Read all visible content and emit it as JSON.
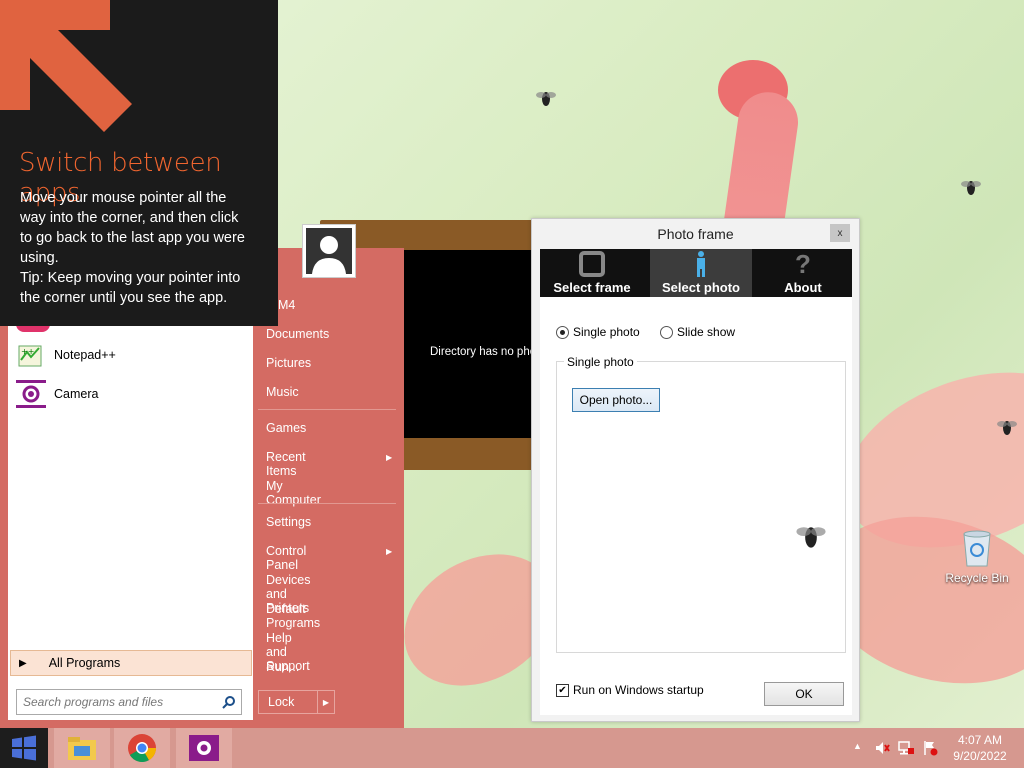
{
  "tooltip": {
    "title": "Switch between apps",
    "lines": [
      "Move your mouse pointer all the",
      "way into the corner, and then click",
      "to go back to the last app you were",
      "using.",
      "Tip: Keep moving your pointer into",
      "the corner until you see the app."
    ]
  },
  "start_menu": {
    "programs": [
      {
        "label": "Notepad++",
        "icon": "notepad-plus-icon"
      },
      {
        "label": "Camera",
        "icon": "camera-icon"
      }
    ],
    "all_programs": "All Programs",
    "search_placeholder": "Search programs and files",
    "right_items": [
      {
        "label": "M4"
      },
      {
        "label": "Documents"
      },
      {
        "label": "Pictures"
      },
      {
        "label": "Music"
      },
      {
        "label": "Games"
      },
      {
        "label": "Recent Items"
      },
      {
        "label": "My Computer"
      },
      {
        "label": "Settings"
      },
      {
        "label": "Control Panel"
      },
      {
        "label": "Devices and Printers"
      },
      {
        "label": "Default Programs"
      },
      {
        "label": "Help and Support"
      },
      {
        "label": "Run..."
      }
    ],
    "lock_label": "Lock"
  },
  "photo_widget": {
    "message": "Directory has no photo"
  },
  "dialog": {
    "title": "Photo frame",
    "close": "x",
    "tabs": [
      {
        "label": "Select frame",
        "icon": "frame-icon"
      },
      {
        "label": "Select photo",
        "icon": "person-icon"
      },
      {
        "label": "About",
        "icon": "question-icon"
      }
    ],
    "active_tab": "Select photo",
    "radio_single": "Single photo",
    "radio_slideshow": "Slide show",
    "selected_mode": "Single photo",
    "group_label": "Single photo",
    "open_button": "Open photo...",
    "startup_label": "Run on Windows startup",
    "startup_checked": true,
    "ok_button": "OK"
  },
  "desktop": {
    "recycle_bin": "Recycle Bin"
  },
  "taskbar": {
    "time": "4:07 AM",
    "date": "9/20/2022",
    "pinned": [
      "file-explorer-icon",
      "chrome-icon",
      "camera-app-icon"
    ]
  },
  "colors": {
    "start_menu": "#d46b63",
    "tooltip_title": "#f0652f",
    "taskbar": "#d6988f"
  }
}
